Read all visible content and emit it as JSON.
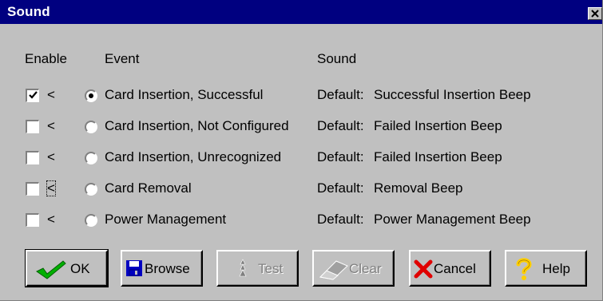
{
  "window": {
    "title": "Sound"
  },
  "headers": {
    "enable": "Enable",
    "event": "Event",
    "sound": "Sound"
  },
  "rows": [
    {
      "enabled": true,
      "marker": "<",
      "selected": true,
      "event": "Card Insertion, Successful",
      "sound_prefix": "Default:",
      "sound_name": "Successful Insertion Beep"
    },
    {
      "enabled": false,
      "marker": "<",
      "selected": false,
      "event": "Card Insertion, Not Configured",
      "sound_prefix": "Default:",
      "sound_name": "Failed Insertion Beep"
    },
    {
      "enabled": false,
      "marker": "<",
      "selected": false,
      "event": "Card Insertion, Unrecognized",
      "sound_prefix": "Default:",
      "sound_name": "Failed Insertion Beep"
    },
    {
      "enabled": false,
      "marker": "<",
      "selected": false,
      "event": "Card Removal",
      "sound_prefix": "Default:",
      "sound_name": "Removal Beep"
    },
    {
      "enabled": false,
      "marker": "<",
      "selected": false,
      "event": "Power Management",
      "sound_prefix": "Default:",
      "sound_name": "Power Management Beep"
    }
  ],
  "buttons": {
    "ok": "OK",
    "browse": "Browse",
    "test": "Test",
    "clear": "Clear",
    "cancel": "Cancel",
    "help": "Help"
  },
  "icons": {
    "ok": "checkmark-icon",
    "browse": "floppy-disk-icon",
    "test": "speaker-icon",
    "clear": "eraser-icon",
    "cancel": "red-x-icon",
    "help": "question-mark-icon"
  },
  "colors": {
    "titlebar": "#000080",
    "face": "#c0c0c0",
    "check_green": "#00b000",
    "cancel_red": "#e00000",
    "help_yellow": "#ffd000",
    "floppy_blue": "#0000c0"
  }
}
